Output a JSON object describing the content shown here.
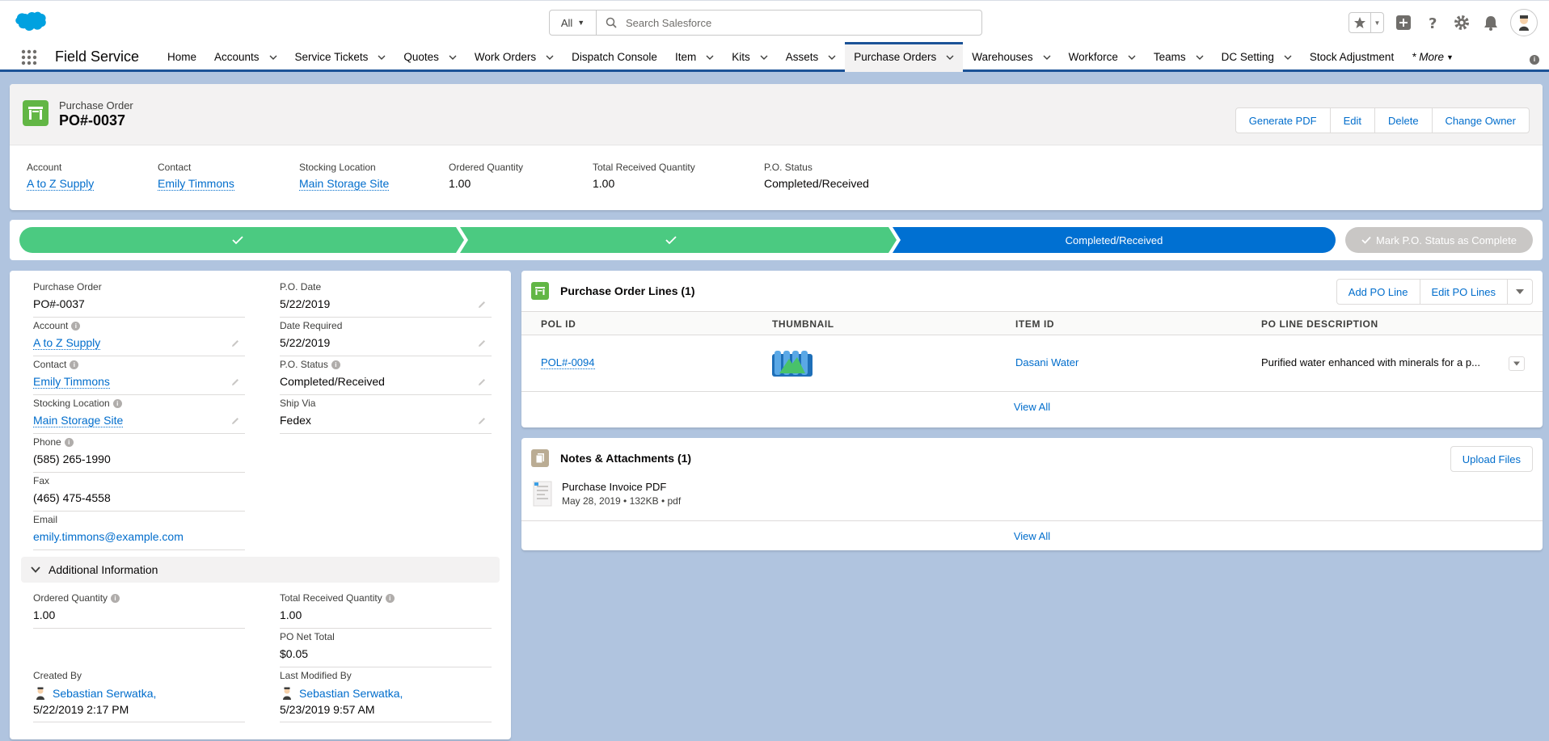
{
  "header": {
    "search_scope": "All",
    "search_placeholder": "Search Salesforce"
  },
  "nav": {
    "app_name": "Field Service",
    "items": [
      {
        "label": "Home",
        "has_menu": false
      },
      {
        "label": "Accounts",
        "has_menu": true
      },
      {
        "label": "Service Tickets",
        "has_menu": true
      },
      {
        "label": "Quotes",
        "has_menu": true
      },
      {
        "label": "Work Orders",
        "has_menu": true
      },
      {
        "label": "Dispatch Console",
        "has_menu": false
      },
      {
        "label": "Item",
        "has_menu": true
      },
      {
        "label": "Kits",
        "has_menu": true
      },
      {
        "label": "Assets",
        "has_menu": true
      },
      {
        "label": "Purchase Orders",
        "has_menu": true,
        "active": true
      },
      {
        "label": "Warehouses",
        "has_menu": true
      },
      {
        "label": "Workforce",
        "has_menu": true
      },
      {
        "label": "Teams",
        "has_menu": true
      },
      {
        "label": "DC Setting",
        "has_menu": true
      },
      {
        "label": "Stock Adjustment",
        "has_menu": false
      }
    ],
    "more_label": "* More"
  },
  "record": {
    "type_label": "Purchase Order",
    "title": "PO#-0037",
    "buttons": [
      "Generate PDF",
      "Edit",
      "Delete",
      "Change Owner"
    ],
    "highlights": {
      "account_label": "Account",
      "account_value": "A to Z Supply",
      "contact_label": "Contact",
      "contact_value": "Emily Timmons",
      "stocking_label": "Stocking Location",
      "stocking_value": "Main Storage Site",
      "ordered_label": "Ordered Quantity",
      "ordered_value": "1.00",
      "received_label": "Total Received Quantity",
      "received_value": "1.00",
      "status_label": "P.O. Status",
      "status_value": "Completed/Received"
    }
  },
  "path": {
    "current_stage": "Completed/Received",
    "mark_button": "Mark P.O. Status as Complete",
    "complete_color": "#4bca81",
    "current_color": "#0070d2"
  },
  "details": {
    "po_label": "Purchase Order",
    "po_value": "PO#-0037",
    "po_date_label": "P.O. Date",
    "po_date_value": "5/22/2019",
    "account_label": "Account",
    "account_value": "A to Z Supply",
    "date_required_label": "Date Required",
    "date_required_value": "5/22/2019",
    "contact_label": "Contact",
    "contact_value": "Emily Timmons",
    "status_label": "P.O. Status",
    "status_value": "Completed/Received",
    "stocking_label": "Stocking Location",
    "stocking_value": "Main Storage Site",
    "ship_via_label": "Ship Via",
    "ship_via_value": "Fedex",
    "phone_label": "Phone",
    "phone_value": "(585) 265-1990",
    "fax_label": "Fax",
    "fax_value": "(465) 475-4558",
    "email_label": "Email",
    "email_value": "emily.timmons@example.com",
    "additional_section": "Additional Information",
    "ordered_label": "Ordered Quantity",
    "ordered_value": "1.00",
    "received_label": "Total Received Quantity",
    "received_value": "1.00",
    "net_total_label": "PO Net Total",
    "net_total_value": "$0.05",
    "created_label": "Created By",
    "created_user": "Sebastian Serwatka,",
    "created_date": "5/22/2019 2:17 PM",
    "modified_label": "Last Modified By",
    "modified_user": "Sebastian Serwatka,",
    "modified_date": "5/23/2019 9:57 AM"
  },
  "po_lines": {
    "title": "Purchase Order Lines (1)",
    "buttons": [
      "Add PO Line",
      "Edit PO Lines"
    ],
    "columns": [
      "POL ID",
      "THUMBNAIL",
      "ITEM ID",
      "PO LINE DESCRIPTION"
    ],
    "rows": [
      {
        "pol_id": "POL#-0094",
        "item_id": "Dasani Water",
        "description": "Purified water enhanced with minerals for a p..."
      }
    ],
    "view_all": "View All"
  },
  "notes": {
    "title": "Notes & Attachments (1)",
    "upload_button": "Upload Files",
    "file_name": "Purchase Invoice PDF",
    "file_meta": "May 28, 2019 • 132KB • pdf",
    "view_all": "View All"
  }
}
